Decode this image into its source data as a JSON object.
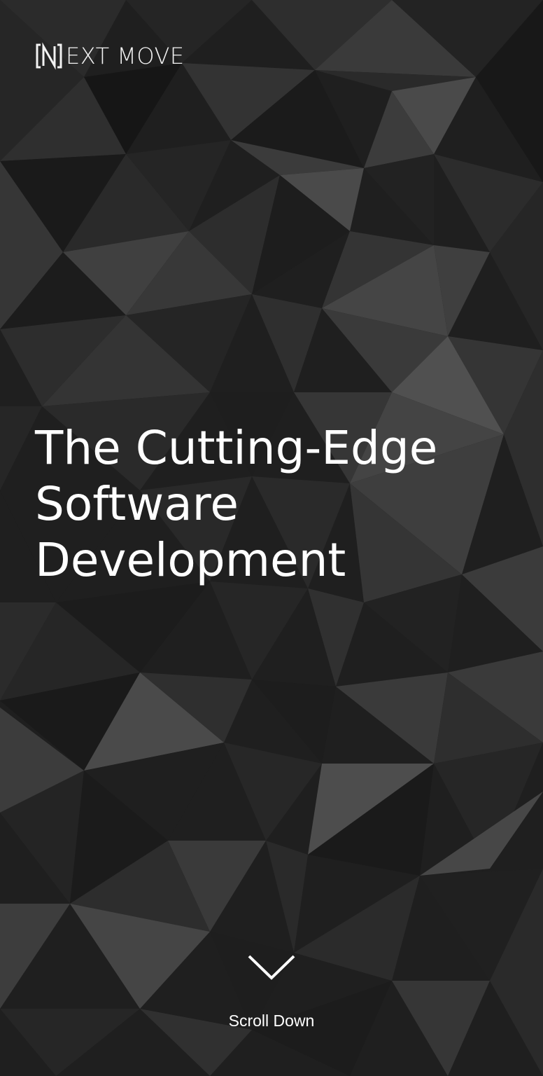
{
  "brand": {
    "mark_letter": "N",
    "text": "EXT MOVE"
  },
  "hero": {
    "headline_lines": [
      "The Cutting-Edge",
      "Software",
      "Development"
    ]
  },
  "scroll": {
    "label": "Scroll Down",
    "icon": "chevron-down-icon"
  },
  "colors": {
    "background_dark": "#1e1e1e",
    "text": "#ffffff"
  }
}
